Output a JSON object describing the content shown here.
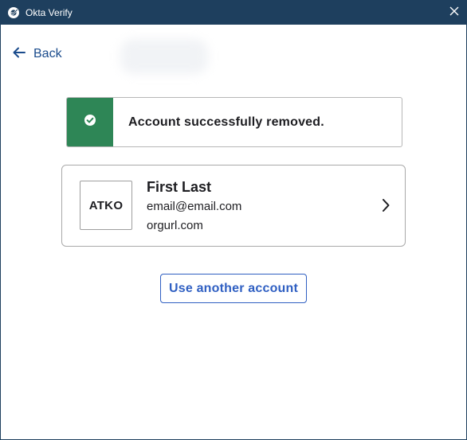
{
  "window": {
    "title": "Okta Verify",
    "app_icon": "okta-verify-icon",
    "close_icon": "close-icon"
  },
  "nav": {
    "back_label": "Back",
    "back_icon": "arrow-left-icon"
  },
  "banner": {
    "status": "success",
    "icon": "check-circle-icon",
    "message": "Account successfully removed."
  },
  "account": {
    "logo_text": "ATKO",
    "name": "First Last",
    "email": "email@email.com",
    "org_url": "orgurl.com",
    "chevron_icon": "chevron-right-icon"
  },
  "actions": {
    "use_another_label": "Use another account"
  },
  "colors": {
    "titlebar": "#1e3f5e",
    "success": "#2e8656",
    "link": "#1a4b8c",
    "button_accent": "#2f5fc2",
    "text": "#1d1d21"
  }
}
